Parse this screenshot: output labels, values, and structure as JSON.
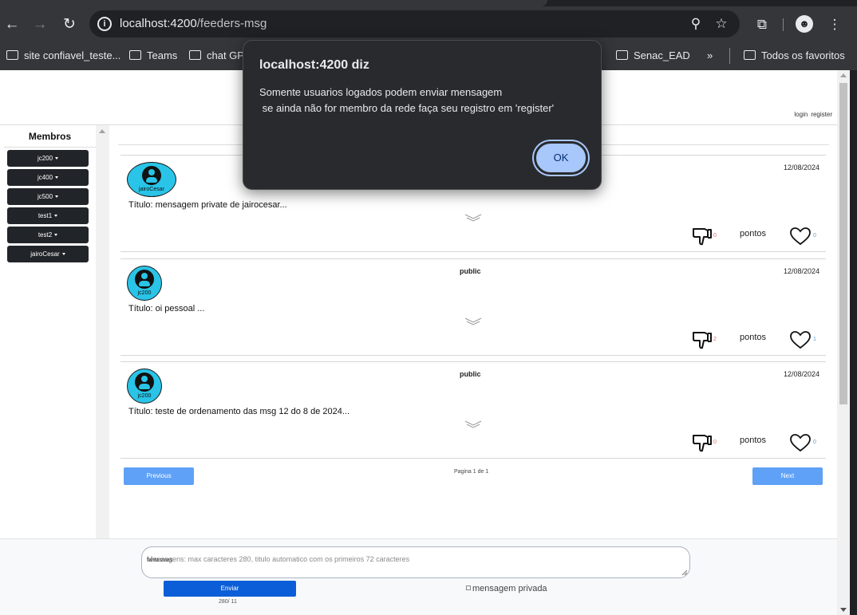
{
  "browser": {
    "url_host": "localhost:4200",
    "url_path": "/feeders-msg",
    "bookmarks": [
      "site confiavel_teste...",
      "Teams",
      "chat GPT",
      "Senac_EAD",
      "Todos os favoritos"
    ],
    "overflow_label": "»"
  },
  "header": {
    "login_label": "login",
    "register_label": "register"
  },
  "sidebar": {
    "title": "Membros",
    "members": [
      "jc200",
      "jc400",
      "jc500",
      "test1",
      "test2",
      "jairoCesar"
    ]
  },
  "posts": [
    {
      "username": "jairoCesar",
      "visibility": "",
      "date": "12/08/2024",
      "title": "Título: mensagem private de jairocesar...",
      "dislikes": "0",
      "points_label": "pontos",
      "likes": "0"
    },
    {
      "username": "jc200",
      "visibility": "public",
      "date": "12/08/2024",
      "title": "Título: oi pessoal ...",
      "dislikes": "2",
      "points_label": "pontos",
      "likes": "1"
    },
    {
      "username": "jc200",
      "visibility": "public",
      "date": "12/08/2024",
      "title": "Título: teste de ordenamento das msg 12 do 8 de 2024...",
      "dislikes": "0",
      "points_label": "pontos",
      "likes": "0"
    }
  ],
  "pager": {
    "previous": "Previous",
    "info": "Pagina 1 de 1",
    "next": "Next"
  },
  "composer": {
    "placeholder": "Mensagens: max caracteres 280, titulo automatico com os primeiros 72 caracteres",
    "value": "fantasmas",
    "send_label": "Enviar",
    "counter": "280/ 11",
    "private_label": "mensagem privada"
  },
  "dialog": {
    "title": "localhost:4200 diz",
    "message": "Somente usuarios logados podem enviar mensagem\n se ainda não for membro da rede faça seu registro em 'register'",
    "ok_label": "OK"
  },
  "colors": {
    "avatar": "#29c4e8",
    "dark_button": "#212529",
    "pager": "#5ea1f7",
    "send": "#0b5ed7",
    "dialog_ok": "#a8c7fa"
  }
}
